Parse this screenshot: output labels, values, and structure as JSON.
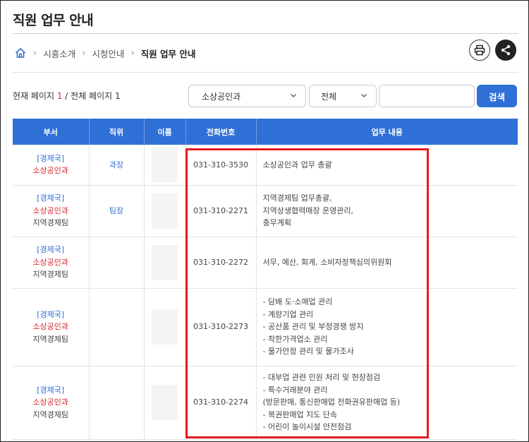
{
  "header": {
    "title": "직원 업무 안내"
  },
  "breadcrumb": {
    "items": [
      "시흥소개",
      "시청안내"
    ],
    "current": "직원 업무 안내"
  },
  "pagination": {
    "prefix": "현재 페이지 ",
    "current": "1",
    "middle": " / 전체 페이지 ",
    "total": "1"
  },
  "search": {
    "dept_selected": "소상공인과",
    "field_selected": "전체",
    "input_value": "",
    "button_label": "검색"
  },
  "table": {
    "headers": [
      "부서",
      "직위",
      "이름",
      "전화번호",
      "업무 내용"
    ],
    "rows": [
      {
        "bureau": "[경제국]",
        "dept": "소상공인과",
        "team": "",
        "position": "과장",
        "name": "",
        "phone": "031-310-3530",
        "tasks": [
          "소상공인과 업무 총괄"
        ]
      },
      {
        "bureau": "[경제국]",
        "dept": "소상공인과",
        "team": "지역경제팀",
        "position": "팀장",
        "name": "",
        "phone": "031-310-2271",
        "tasks": [
          "지역경제팀 업무총괄,",
          "지역상생협력매장 운영관리,",
          "충무계획"
        ]
      },
      {
        "bureau": "[경제국]",
        "dept": "소상공인과",
        "team": "지역경제팀",
        "position": "",
        "name": "",
        "phone": "031-310-2272",
        "tasks": [
          "서무, 예산, 회계, 소비자정책심의위원회"
        ]
      },
      {
        "bureau": "[경제국]",
        "dept": "소상공인과",
        "team": "지역경제팀",
        "position": "",
        "name": "",
        "phone": "031-310-2273",
        "tasks": [
          "- 담배 도·소매업 관리",
          "- 계량기업 관리",
          "- 공산품 관리 및 부정경쟁 방지",
          "- 착한가격업소 관리",
          "- 물가안정 관리 및 물가조사"
        ]
      },
      {
        "bureau": "[경제국]",
        "dept": "소상공인과",
        "team": "지역경제팀",
        "position": "",
        "name": "",
        "phone": "031-310-2274",
        "tasks": [
          "- 대부업 관련 민원 처리 및 현장점검",
          "- 특수거래분야 관리",
          "(방문판매, 통신판매업 전화권유판매업 등)",
          "- 복권판매업 지도 단속",
          "- 어린이 놀이시설 안전점검"
        ]
      }
    ]
  },
  "colors": {
    "accent": "#2f70d6",
    "dept_red": "#d6262c",
    "highlight": "#e61b1b"
  }
}
